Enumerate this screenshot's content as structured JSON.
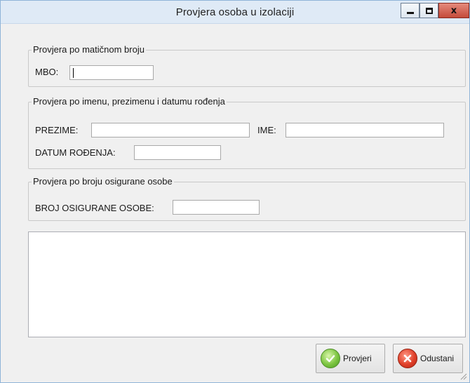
{
  "window": {
    "title": "Provjera osoba u izolaciji"
  },
  "group_mbo": {
    "legend": "Provjera po matičnom broju",
    "mbo_label": "MBO:",
    "mbo_value": ""
  },
  "group_name": {
    "legend": "Provjera po imenu, prezimenu i datumu rođenja",
    "surname_label": "PREZIME:",
    "surname_value": "",
    "name_label": "IME:",
    "name_value": "",
    "dob_label": "DATUM ROĐENJA:",
    "dob_value": ""
  },
  "group_insured": {
    "legend": "Provjera po broju osigurane osobe",
    "insured_label": "BROJ OSIGURANE OSOBE:",
    "insured_value": ""
  },
  "results": {
    "text": ""
  },
  "buttons": {
    "check_label": "Provjeri",
    "cancel_label": "Odustani"
  },
  "icons": {
    "check": "check-circle-icon",
    "cancel": "cancel-circle-icon",
    "minimize": "minimize-icon",
    "maximize": "maximize-icon",
    "close": "close-icon",
    "resize_grip": "resize-grip-icon"
  }
}
